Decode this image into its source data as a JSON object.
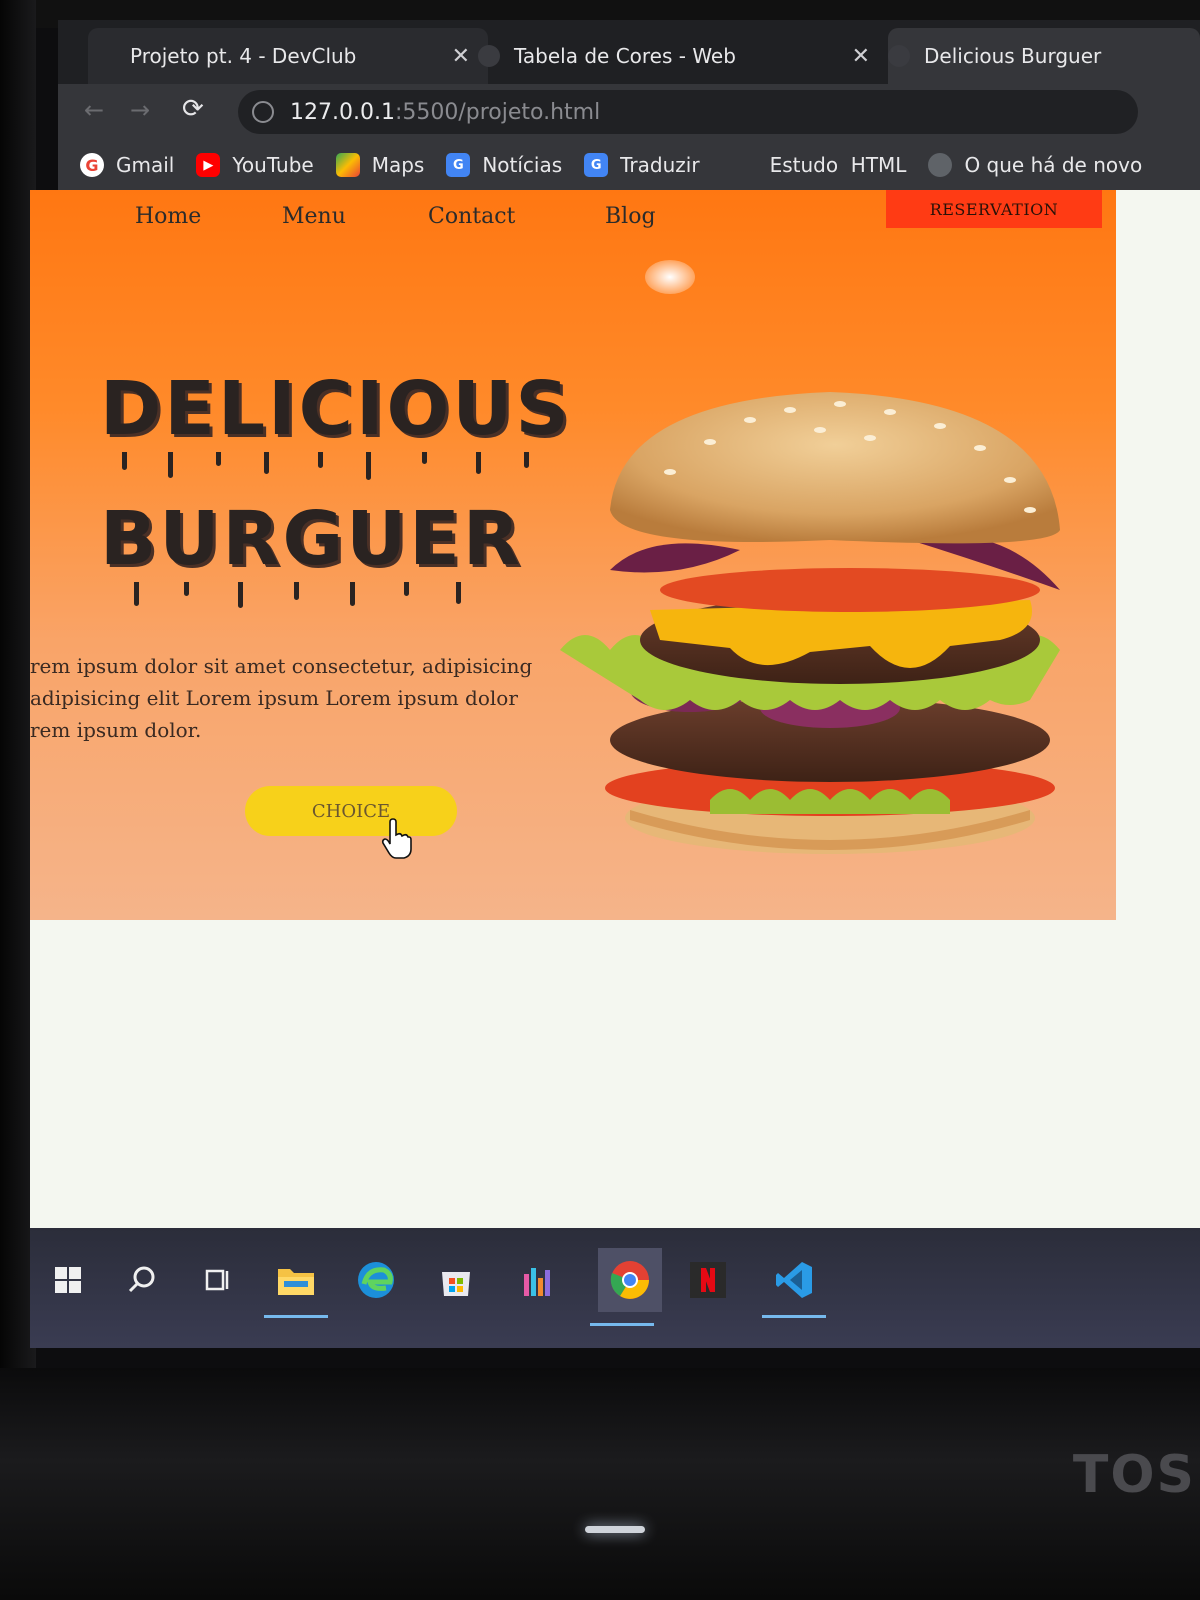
{
  "browser": {
    "tabs": [
      {
        "label": "Projeto pt. 4 - DevClub",
        "close": "✕"
      },
      {
        "label": "Tabela de Cores - Web",
        "close": "✕"
      },
      {
        "label": "Delicious Burguer"
      }
    ],
    "url_host": "127.0.0.1",
    "url_path": ":5500/projeto.html",
    "bookmarks": [
      {
        "label": "Gmail",
        "icon": "gmail-icon",
        "glyph": "G"
      },
      {
        "label": "YouTube",
        "icon": "youtube-icon",
        "glyph": "▶"
      },
      {
        "label": "Maps",
        "icon": "maps-icon",
        "glyph": ""
      },
      {
        "label": "Notícias",
        "icon": "news-icon",
        "glyph": "G"
      },
      {
        "label": "Traduzir",
        "icon": "translate-icon",
        "glyph": "G"
      },
      {
        "label": "Estudo  HTML",
        "icon": "",
        "glyph": ""
      },
      {
        "label": "O que há de novo",
        "icon": "chrome-icon",
        "glyph": ""
      }
    ]
  },
  "site": {
    "nav": [
      "Home",
      "Menu",
      "Contact",
      "Blog"
    ],
    "reservation_label": "RESERVATION",
    "title_line1": "DELICIOUS",
    "title_line2": "BURGUER",
    "text_lines": [
      "rem ipsum dolor sit amet consectetur, adipisicing",
      "adipisicing elit Lorem ipsum Lorem ipsum dolor",
      "rem ipsum dolor."
    ],
    "choice_label": "CHOICE"
  },
  "colors": {
    "hero_orange": "#ff7712",
    "reservation_red": "#ff3b14",
    "choice_yellow": "#f7d11a",
    "title_dark": "#2a2321"
  },
  "taskbar": {
    "items": [
      "windows-start-icon",
      "search-icon",
      "task-view-icon",
      "file-explorer-icon",
      "edge-icon",
      "store-icon",
      "app-icon",
      "chrome-icon",
      "netflix-icon",
      "vscode-icon"
    ]
  },
  "bezel": {
    "brand": "TOS"
  }
}
